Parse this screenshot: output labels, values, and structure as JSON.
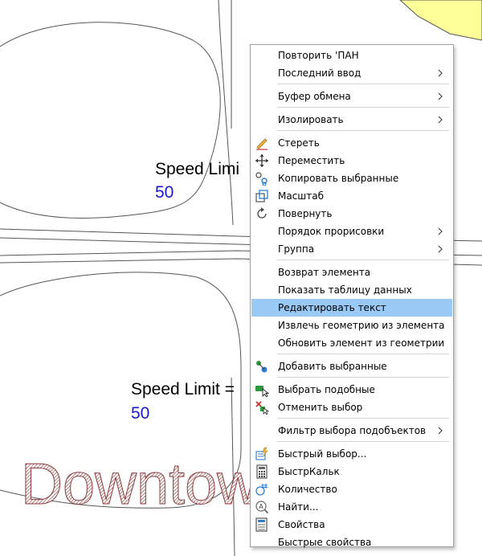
{
  "drawing": {
    "labels": [
      {
        "text": "Speed Limi",
        "value": "50"
      },
      {
        "text": "Speed Limit =",
        "value": "50"
      }
    ],
    "watermark": "Downtown g"
  },
  "context_menu": {
    "items": [
      {
        "label": "Повторить 'ПАН",
        "submenu": false
      },
      {
        "label": "Последний ввод",
        "submenu": true
      },
      {
        "label": "Буфер обмена",
        "submenu": true
      },
      {
        "label": "Изолировать",
        "submenu": true
      },
      {
        "label": "Стереть",
        "icon": "eraser-icon"
      },
      {
        "label": "Переместить",
        "icon": "move-icon"
      },
      {
        "label": "Копировать выбранные",
        "icon": "copy-icon"
      },
      {
        "label": "Масштаб",
        "icon": "scale-icon"
      },
      {
        "label": "Повернуть",
        "icon": "rotate-icon"
      },
      {
        "label": "Порядок прорисовки",
        "submenu": true
      },
      {
        "label": "Группа",
        "submenu": true
      },
      {
        "label": "Возврат элемента"
      },
      {
        "label": "Показать таблицу данных"
      },
      {
        "label": "Редактировать текст",
        "highlighted": true
      },
      {
        "label": "Извлечь геометрию из элемента"
      },
      {
        "label": "Обновить элемент из геометрии"
      },
      {
        "label": "Добавить выбранные",
        "icon": "add-selected-icon"
      },
      {
        "label": "Выбрать подобные",
        "icon": "select-similar-icon"
      },
      {
        "label": "Отменить выбор",
        "icon": "deselect-icon"
      },
      {
        "label": "Фильтр выбора подобъектов",
        "submenu": true
      },
      {
        "label": "Быстрый выбор...",
        "icon": "quick-select-icon"
      },
      {
        "label": "БыстрКальк",
        "icon": "calculator-icon"
      },
      {
        "label": "Количество",
        "icon": "count-icon"
      },
      {
        "label": "Найти...",
        "icon": "find-icon"
      },
      {
        "label": "Свойства",
        "icon": "properties-icon"
      },
      {
        "label": "Быстрые свойства"
      }
    ]
  },
  "colors": {
    "highlight": "#99c9f5",
    "value_text": "#1a1acc",
    "yellow_fill": "#ffff99",
    "watermark": "#a05a5a"
  }
}
